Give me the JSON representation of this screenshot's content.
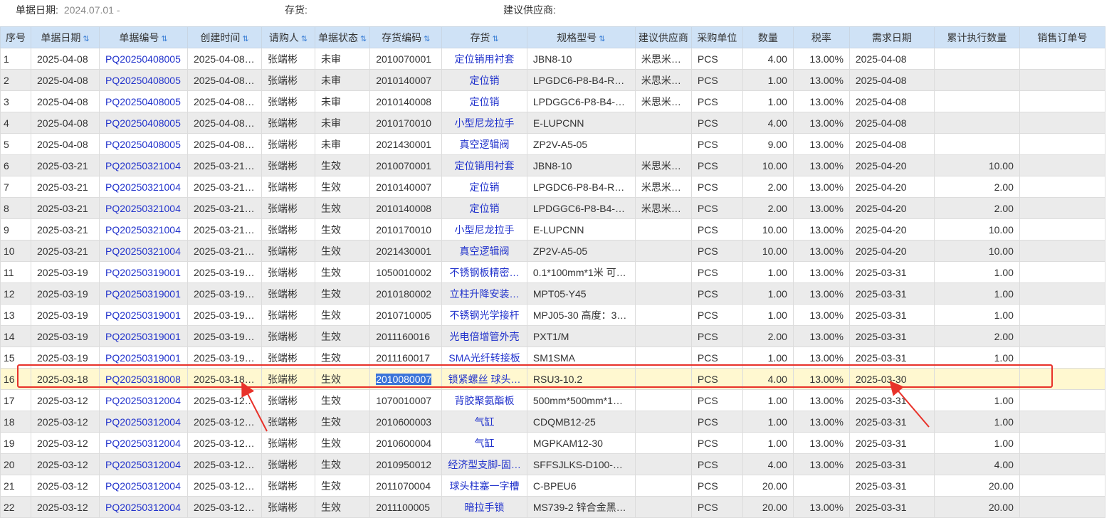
{
  "filters": {
    "date_label": "单据日期:",
    "date_value": "2024.07.01 -",
    "stock_label": "存货:",
    "supplier_label": "建议供应商:"
  },
  "columns": [
    "序号",
    "单据日期",
    "单据编号",
    "创建时间",
    "请购人",
    "单据状态",
    "存货编码",
    "存货",
    "规格型号",
    "建议供应商",
    "采购单位",
    "数量",
    "税率",
    "需求日期",
    "累计执行数量",
    "销售订单号"
  ],
  "sort_glyph": "⇅",
  "rows": [
    [
      "1",
      "2025-04-08",
      "PQ20250408005",
      "2025-04-08…",
      "张端彬",
      "未审",
      "2010070001",
      "定位销用衬套",
      "JBN8-10",
      "米思米…",
      "PCS",
      "4.00",
      "13.00%",
      "2025-04-08",
      "",
      ""
    ],
    [
      "2",
      "2025-04-08",
      "PQ20250408005",
      "2025-04-08…",
      "张端彬",
      "未审",
      "2010140007",
      "定位销",
      "LPGDC6-P8-B4-R…",
      "米思米…",
      "PCS",
      "1.00",
      "13.00%",
      "2025-04-08",
      "",
      ""
    ],
    [
      "3",
      "2025-04-08",
      "PQ20250408005",
      "2025-04-08…",
      "张端彬",
      "未审",
      "2010140008",
      "定位销",
      "LPDGGC6-P8-B4-…",
      "米思米…",
      "PCS",
      "1.00",
      "13.00%",
      "2025-04-08",
      "",
      ""
    ],
    [
      "4",
      "2025-04-08",
      "PQ20250408005",
      "2025-04-08…",
      "张端彬",
      "未审",
      "2010170010",
      "小型尼龙拉手",
      "E-LUPCNN",
      "",
      "PCS",
      "4.00",
      "13.00%",
      "2025-04-08",
      "",
      ""
    ],
    [
      "5",
      "2025-04-08",
      "PQ20250408005",
      "2025-04-08…",
      "张端彬",
      "未审",
      "2021430001",
      "真空逻辑阀",
      "ZP2V-A5-05",
      "",
      "PCS",
      "9.00",
      "13.00%",
      "2025-04-08",
      "",
      ""
    ],
    [
      "6",
      "2025-03-21",
      "PQ20250321004",
      "2025-03-21…",
      "张端彬",
      "生效",
      "2010070001",
      "定位销用衬套",
      "JBN8-10",
      "米思米…",
      "PCS",
      "10.00",
      "13.00%",
      "2025-04-20",
      "10.00",
      ""
    ],
    [
      "7",
      "2025-03-21",
      "PQ20250321004",
      "2025-03-21…",
      "张端彬",
      "生效",
      "2010140007",
      "定位销",
      "LPGDC6-P8-B4-R…",
      "米思米…",
      "PCS",
      "2.00",
      "13.00%",
      "2025-04-20",
      "2.00",
      ""
    ],
    [
      "8",
      "2025-03-21",
      "PQ20250321004",
      "2025-03-21…",
      "张端彬",
      "生效",
      "2010140008",
      "定位销",
      "LPDGGC6-P8-B4-…",
      "米思米…",
      "PCS",
      "2.00",
      "13.00%",
      "2025-04-20",
      "2.00",
      ""
    ],
    [
      "9",
      "2025-03-21",
      "PQ20250321004",
      "2025-03-21…",
      "张端彬",
      "生效",
      "2010170010",
      "小型尼龙拉手",
      "E-LUPCNN",
      "",
      "PCS",
      "10.00",
      "13.00%",
      "2025-04-20",
      "10.00",
      ""
    ],
    [
      "10",
      "2025-03-21",
      "PQ20250321004",
      "2025-03-21…",
      "张端彬",
      "生效",
      "2021430001",
      "真空逻辑阀",
      "ZP2V-A5-05",
      "",
      "PCS",
      "10.00",
      "13.00%",
      "2025-04-20",
      "10.00",
      ""
    ],
    [
      "11",
      "2025-03-19",
      "PQ20250319001",
      "2025-03-19…",
      "张端彬",
      "生效",
      "1050010002",
      "不锈钢板精密…",
      "0.1*100mm*1米 可…",
      "",
      "PCS",
      "1.00",
      "13.00%",
      "2025-03-31",
      "1.00",
      ""
    ],
    [
      "12",
      "2025-03-19",
      "PQ20250319001",
      "2025-03-19…",
      "张端彬",
      "生效",
      "2010180002",
      "立柱升降安装…",
      "MPT05-Y45",
      "",
      "PCS",
      "1.00",
      "13.00%",
      "2025-03-31",
      "1.00",
      ""
    ],
    [
      "13",
      "2025-03-19",
      "PQ20250319001",
      "2025-03-19…",
      "张端彬",
      "生效",
      "2010710005",
      "不锈钢光学接杆",
      "MPJ05-30 高度：3…",
      "",
      "PCS",
      "1.00",
      "13.00%",
      "2025-03-31",
      "1.00",
      ""
    ],
    [
      "14",
      "2025-03-19",
      "PQ20250319001",
      "2025-03-19…",
      "张端彬",
      "生效",
      "2011160016",
      "光电倍增管外壳",
      "PXT1/M",
      "",
      "PCS",
      "2.00",
      "13.00%",
      "2025-03-31",
      "2.00",
      ""
    ],
    [
      "15",
      "2025-03-19",
      "PQ20250319001",
      "2025-03-19…",
      "张端彬",
      "生效",
      "2011160017",
      "SMA光纤转接板",
      "SM1SMA",
      "",
      "PCS",
      "1.00",
      "13.00%",
      "2025-03-31",
      "1.00",
      ""
    ],
    [
      "16",
      "2025-03-18",
      "PQ20250318008",
      "2025-03-18…",
      "张端彬",
      "生效",
      "2010080007",
      "锁紧螺丝 球头…",
      "RSU3-10.2",
      "",
      "PCS",
      "4.00",
      "13.00%",
      "2025-03-30",
      "",
      ""
    ],
    [
      "17",
      "2025-03-12",
      "PQ20250312004",
      "2025-03-12…",
      "张端彬",
      "生效",
      "1070010007",
      "背胶聚氨酯板",
      "500mm*500mm*1…",
      "",
      "PCS",
      "1.00",
      "13.00%",
      "2025-03-31",
      "1.00",
      ""
    ],
    [
      "18",
      "2025-03-12",
      "PQ20250312004",
      "2025-03-12…",
      "张端彬",
      "生效",
      "2010600003",
      "气缸",
      "CDQMB12-25",
      "",
      "PCS",
      "1.00",
      "13.00%",
      "2025-03-31",
      "1.00",
      ""
    ],
    [
      "19",
      "2025-03-12",
      "PQ20250312004",
      "2025-03-12…",
      "张端彬",
      "生效",
      "2010600004",
      "气缸",
      "MGPKAM12-30",
      "",
      "PCS",
      "1.00",
      "13.00%",
      "2025-03-31",
      "1.00",
      ""
    ],
    [
      "20",
      "2025-03-12",
      "PQ20250312004",
      "2025-03-12…",
      "张端彬",
      "生效",
      "2010950012",
      "经济型支脚-固…",
      "SFFSJLKS-D100-…",
      "",
      "PCS",
      "4.00",
      "13.00%",
      "2025-03-31",
      "4.00",
      ""
    ],
    [
      "21",
      "2025-03-12",
      "PQ20250312004",
      "2025-03-12…",
      "张端彬",
      "生效",
      "2011070004",
      "球头柱塞一字槽",
      "C-BPEU6",
      "",
      "PCS",
      "20.00",
      "",
      "2025-03-31",
      "20.00",
      ""
    ],
    [
      "22",
      "2025-03-12",
      "PQ20250312004",
      "2025-03-12…",
      "张端彬",
      "生效",
      "2011100005",
      "暗拉手锁",
      "MS739-2 锌合金黑…",
      "",
      "PCS",
      "20.00",
      "13.00%",
      "2025-03-31",
      "20.00",
      ""
    ]
  ],
  "highlighted_row": 16,
  "selected_text": "2010080007",
  "colors": {
    "header_bg": "#cfe2f6",
    "link": "#2233cc",
    "highlight_row": "#fff8d0",
    "annotation": "#e8322a",
    "selection": "#3b74d9"
  }
}
